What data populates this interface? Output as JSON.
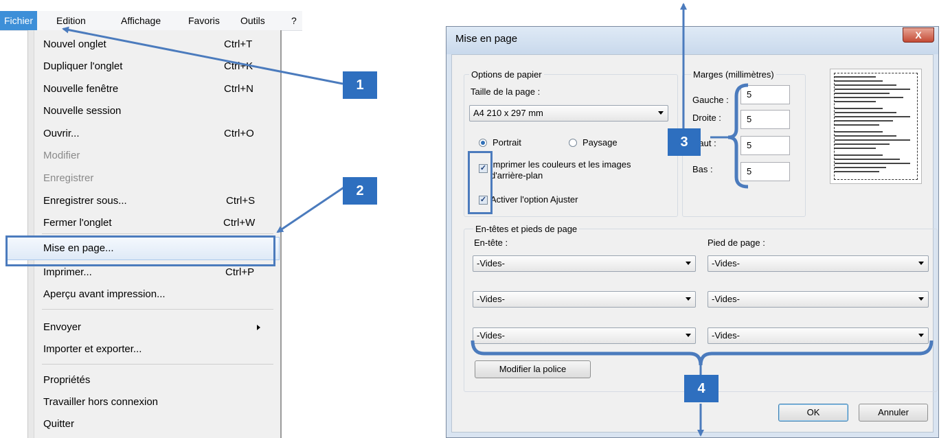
{
  "menubar": {
    "items": [
      "Fichier",
      "Edition",
      "Affichage",
      "Favoris",
      "Outils",
      "?"
    ]
  },
  "file_menu": {
    "items": [
      {
        "label": "Nouvel onglet",
        "shortcut": "Ctrl+T"
      },
      {
        "label": "Dupliquer l'onglet",
        "shortcut": "Ctrl+K"
      },
      {
        "label": "Nouvelle fenêtre",
        "shortcut": "Ctrl+N"
      },
      {
        "label": "Nouvelle session",
        "shortcut": ""
      },
      {
        "label": "Ouvrir...",
        "shortcut": "Ctrl+O"
      },
      {
        "label": "Modifier",
        "shortcut": ""
      },
      {
        "label": "Enregistrer",
        "shortcut": ""
      },
      {
        "label": "Enregistrer sous...",
        "shortcut": "Ctrl+S"
      },
      {
        "label": "Fermer l'onglet",
        "shortcut": "Ctrl+W"
      },
      {
        "label": "Mise en page...",
        "shortcut": ""
      },
      {
        "label": "Imprimer...",
        "shortcut": "Ctrl+P"
      },
      {
        "label": "Aperçu avant impression...",
        "shortcut": ""
      },
      {
        "label": "Envoyer",
        "shortcut": ""
      },
      {
        "label": "Importer et exporter...",
        "shortcut": ""
      },
      {
        "label": "Propriétés",
        "shortcut": ""
      },
      {
        "label": "Travailler hors connexion",
        "shortcut": ""
      },
      {
        "label": "Quitter",
        "shortcut": ""
      }
    ]
  },
  "badges": [
    "1",
    "2",
    "3",
    "4"
  ],
  "dialog": {
    "title": "Mise en page",
    "close": "X",
    "paper": {
      "group_label": "Options de papier",
      "size_label": "Taille de la page :",
      "size_value": "A4 210 x 297 mm",
      "portrait": "Portrait",
      "landscape": "Paysage",
      "print_bg": "Imprimer les couleurs et les images",
      "print_bg_2": "d'arrière-plan",
      "shrink": "Activer l'option Ajuster"
    },
    "margins": {
      "group_label": "Marges (millimètres)",
      "left_label": "Gauche :",
      "right_label": "Droite :",
      "top_label": "Haut :",
      "bottom_label": "Bas :",
      "left": "5",
      "right": "5",
      "top": "5",
      "bottom": "5"
    },
    "headers": {
      "group_label": "En-têtes et pieds de page",
      "header_label": "En-tête :",
      "footer_label": "Pied de page :",
      "header_values": [
        "-Vides-",
        "-Vides-",
        "-Vides-"
      ],
      "footer_values": [
        "-Vides-",
        "-Vides-",
        "-Vides-"
      ],
      "font_button": "Modifier la police"
    },
    "ok": "OK",
    "cancel": "Annuler"
  },
  "colors": {
    "accent": "#2e6fbf",
    "menu_active": "#3d8fd8"
  }
}
